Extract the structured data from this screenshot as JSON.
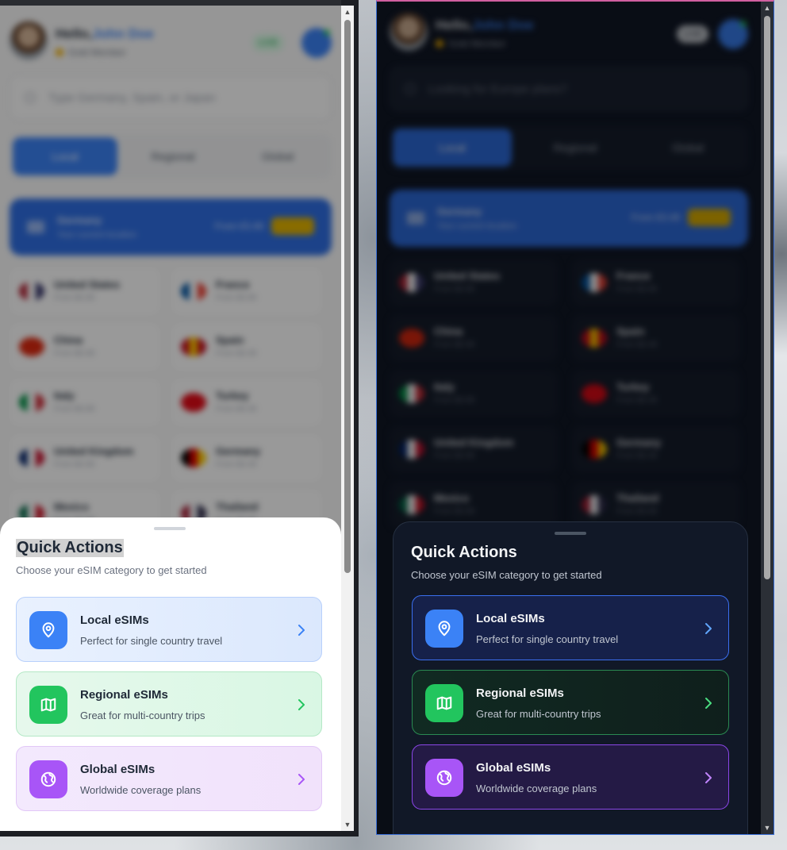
{
  "app": {
    "greeting_prefix": "Hello,",
    "user_name": "John Doe",
    "member_status": "Gold Member",
    "badge_light": "LIVE",
    "badge_dark": "LIVE"
  },
  "search": {
    "light_placeholder": "Type Germany, Spain, or Japan",
    "dark_placeholder": "Looking for Europe plans?"
  },
  "tabs": [
    "Local",
    "Regional",
    "Global"
  ],
  "featured": {
    "country": "Germany",
    "subtitle": "Your current location",
    "price": "From €3.49",
    "tag": "HOT"
  },
  "countries": [
    {
      "name": "United States",
      "price": "From $4.99",
      "flag": [
        "#b22234",
        "#ffffff",
        "#3c3b6e"
      ]
    },
    {
      "name": "France",
      "price": "From $3.99",
      "flag": [
        "#0055a4",
        "#ffffff",
        "#ef4135"
      ]
    },
    {
      "name": "China",
      "price": "From $5.99",
      "flag": [
        "#de2910",
        "#de2910",
        "#de2910"
      ]
    },
    {
      "name": "Spain",
      "price": "From $3.49",
      "flag": [
        "#c60b1e",
        "#ffc400",
        "#c60b1e"
      ]
    },
    {
      "name": "Italy",
      "price": "From $3.99",
      "flag": [
        "#009246",
        "#ffffff",
        "#ce2b37"
      ]
    },
    {
      "name": "Turkey",
      "price": "From $4.49",
      "flag": [
        "#e30a17",
        "#e30a17",
        "#e30a17"
      ]
    },
    {
      "name": "United Kingdom",
      "price": "From $4.99",
      "flag": [
        "#012169",
        "#ffffff",
        "#c8102e"
      ]
    },
    {
      "name": "Germany",
      "price": "From $3.49",
      "flag": [
        "#000000",
        "#dd0000",
        "#ffce00"
      ]
    },
    {
      "name": "Mexico",
      "price": "From $4.99",
      "flag": [
        "#006847",
        "#ffffff",
        "#ce1126"
      ]
    },
    {
      "name": "Thailand",
      "price": "From $3.99",
      "flag": [
        "#a51931",
        "#f4f5f8",
        "#2d2a4a"
      ]
    }
  ],
  "sheet": {
    "title": "Quick Actions",
    "subtitle": "Choose your eSIM category to get started",
    "cards": [
      {
        "title": "Local eSIMs",
        "desc": "Perfect for single country travel",
        "icon": "map-pin-icon",
        "color": "#3b82f6"
      },
      {
        "title": "Regional eSIMs",
        "desc": "Great for multi-country trips",
        "icon": "map-icon",
        "color": "#22c55e"
      },
      {
        "title": "Global eSIMs",
        "desc": "Worldwide coverage plans",
        "icon": "globe-icon",
        "color": "#a855f7"
      }
    ]
  },
  "colors": {
    "accent_blue": "#3b82f6",
    "accent_green": "#22c55e",
    "accent_purple": "#a855f7",
    "dark_bg": "#111827"
  }
}
